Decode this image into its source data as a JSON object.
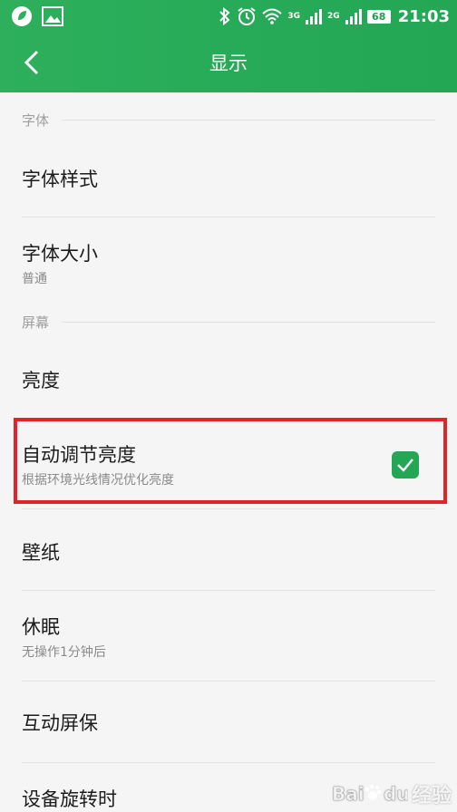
{
  "status_bar": {
    "time": "21:03",
    "battery": "68",
    "network1": "3G",
    "network2": "2G"
  },
  "nav": {
    "title": "显示"
  },
  "sections": {
    "font": "字体",
    "screen": "屏幕"
  },
  "rows": {
    "font_style": {
      "title": "字体样式"
    },
    "font_size": {
      "title": "字体大小",
      "subtitle": "普通"
    },
    "brightness": {
      "title": "亮度"
    },
    "auto_brightness": {
      "title": "自动调节亮度",
      "subtitle": "根据环境光线情况优化亮度",
      "checked": true
    },
    "wallpaper": {
      "title": "壁纸"
    },
    "sleep": {
      "title": "休眠",
      "subtitle": "无操作1分钟后"
    },
    "screensaver": {
      "title": "互动屏保"
    },
    "rotation": {
      "title": "设备旋转时"
    }
  },
  "colors": {
    "accent": "#23a755",
    "highlight": "#e0242e"
  },
  "watermark": {
    "text": "经验"
  }
}
